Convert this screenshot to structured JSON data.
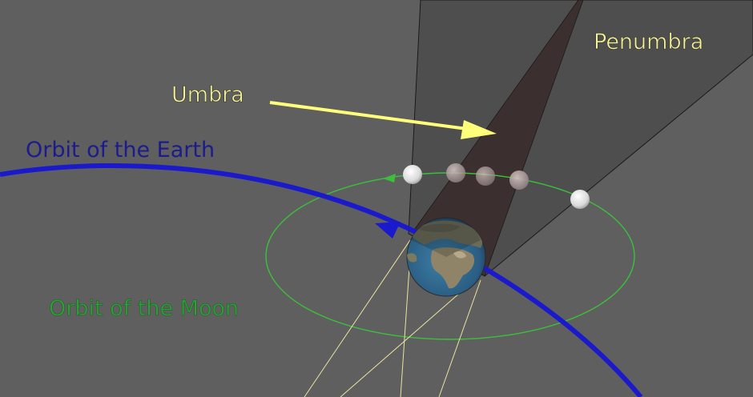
{
  "labels": {
    "umbra": "Umbra",
    "penumbra": "Penumbra",
    "orbit_earth": "Orbit of the Earth",
    "orbit_moon": "Orbit of the Moon"
  },
  "colors": {
    "background": "#5f5f5f",
    "penumbra": "#4e4e4e",
    "umbra": "#3b2f2f",
    "label_yellow": "#f4f2a0",
    "arrow_yellow": "#ffff7a",
    "earth_orbit": "#1a1acc",
    "earth_label": "#1c1c8a",
    "moon_orbit": "#3cc03c",
    "moon_label": "#2f9f3a",
    "sun_rays": "#e8e4a0"
  },
  "icons": {
    "earth": "earth-globe-icon",
    "moon": "moon-icon"
  }
}
